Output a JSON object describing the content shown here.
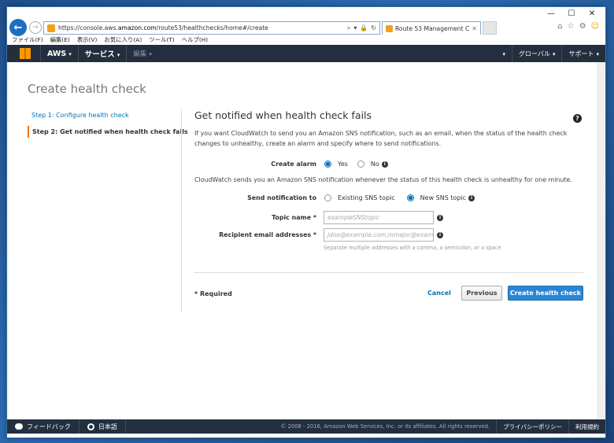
{
  "browser": {
    "url_prefix": "https://console.aws.",
    "url_host": "amazon.com",
    "url_path": "/route53/healthchecks/home#/create",
    "tab_title": "Route 53 Management Con...",
    "menu": [
      "ファイル(F)",
      "編集(E)",
      "表示(V)",
      "お気に入り(A)",
      "ツール(T)",
      "ヘルプ(H)"
    ]
  },
  "nav": {
    "aws": "AWS",
    "services": "サービス",
    "edit": "編集",
    "region": "グローバル",
    "support": "サポート"
  },
  "page": {
    "title": "Create health check",
    "steps": [
      {
        "label": "Step 1: Configure health check"
      },
      {
        "label": "Step 2: Get notified when health check fails"
      }
    ],
    "section_title": "Get notified when health check fails",
    "description": "If you want CloudWatch to send you an Amazon SNS notification, such as an email, when the status of the health check changes to unhealthy, create an alarm and specify where to send notifications.",
    "create_alarm": {
      "label": "Create alarm",
      "yes": "Yes",
      "no": "No"
    },
    "cloudwatch_note": "CloudWatch sends you an Amazon SNS notification whenever the status of this health check is unhealthy for one minute.",
    "send_notification": {
      "label": "Send notification to",
      "existing": "Existing SNS topic",
      "new": "New SNS topic"
    },
    "topic_name": {
      "label": "Topic name *",
      "placeholder": "exampleSNStopic"
    },
    "recipient": {
      "label": "Recipient email addresses *",
      "placeholder": "jdoe@example.com,mmajor@example.com",
      "hint": "Separate multiple addresses with a comma, a semicolon, or a space"
    },
    "required": "* Required",
    "cancel": "Cancel",
    "previous": "Previous",
    "create": "Create health check"
  },
  "footer": {
    "feedback": "フィードバック",
    "language": "日本語",
    "copyright": "© 2008 - 2016, Amazon Web Services, Inc. or its affiliates. All rights reserved.",
    "privacy": "プライバシーポリシー",
    "terms": "利用規約"
  },
  "colors": {
    "nav_bg": "#232f3e",
    "primary": "#2a86d5",
    "link": "#0073bb",
    "accent": "#ec7211"
  }
}
